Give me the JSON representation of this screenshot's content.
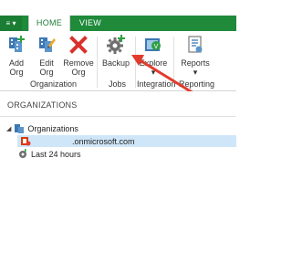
{
  "menu": {
    "icon": "hamburger-menu-icon"
  },
  "tabs": [
    {
      "label": "HOME",
      "active": true
    },
    {
      "label": "VIEW",
      "active": false
    }
  ],
  "ribbon": {
    "buttons": [
      {
        "label1": "Add",
        "label2": "Org",
        "icon": "add-org-icon"
      },
      {
        "label1": "Edit",
        "label2": "Org",
        "icon": "edit-org-icon"
      },
      {
        "label1": "Remove",
        "label2": "Org",
        "icon": "remove-org-icon"
      },
      {
        "label1": "Backup",
        "label2": "",
        "icon": "backup-gear-icon"
      },
      {
        "label1": "Explore",
        "label2": "",
        "icon": "explore-icon"
      },
      {
        "label1": "Reports",
        "label2": "",
        "icon": "reports-icon"
      }
    ],
    "groups": [
      "Organization",
      "Jobs",
      "Integration",
      "Reporting"
    ]
  },
  "panel": {
    "title": "ORGANIZATIONS"
  },
  "tree": {
    "root": "Organizations",
    "org": ".onmicrosoft.com",
    "last": "Last 24 hours"
  },
  "colors": {
    "accent": "#1e8a3a",
    "selected": "#cfe6f8",
    "arrow": "#e23b2e"
  }
}
